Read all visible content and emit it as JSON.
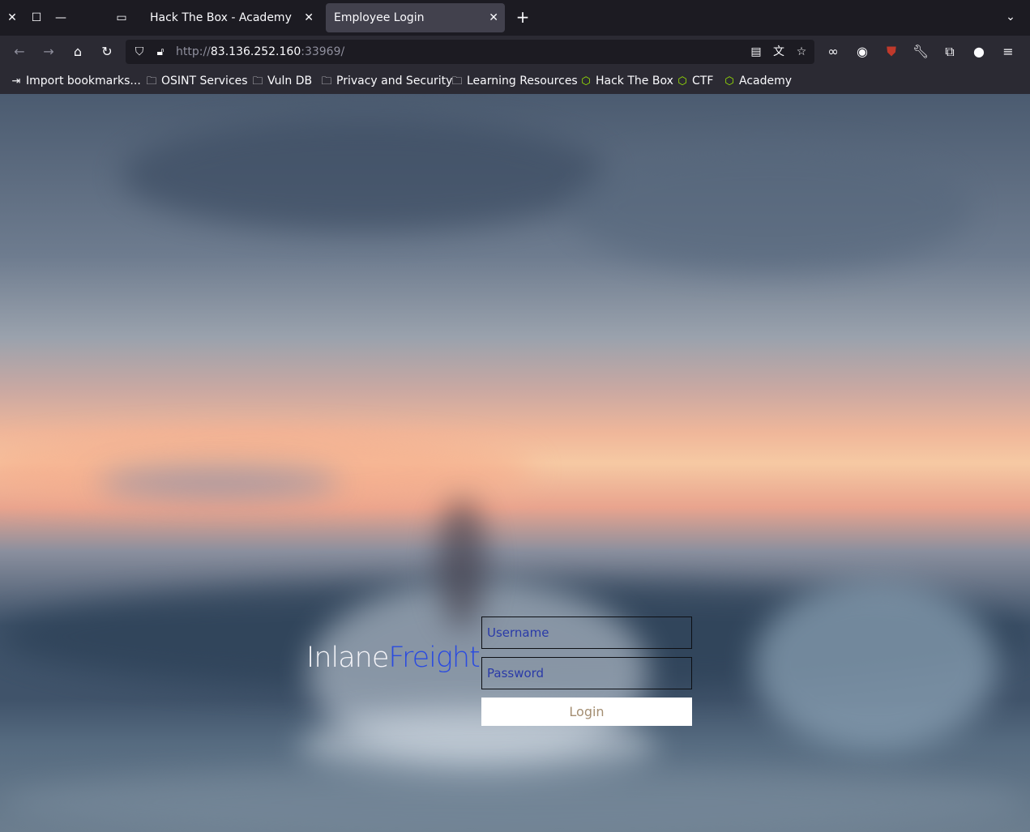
{
  "browser": {
    "tabs": [
      {
        "label": "Hack The Box - Academy",
        "active": false
      },
      {
        "label": "Employee Login",
        "active": true
      }
    ],
    "url": {
      "scheme": "http://",
      "host": "83.136.252.160",
      "rest": ":33969/"
    },
    "bookmarks": [
      {
        "label": "Import bookmarks...",
        "icon": "import-icon"
      },
      {
        "label": "OSINT Services",
        "icon": "folder-icon"
      },
      {
        "label": "Vuln DB",
        "icon": "folder-icon"
      },
      {
        "label": "Privacy and Security",
        "icon": "folder-icon"
      },
      {
        "label": "Learning Resources",
        "icon": "folder-icon"
      },
      {
        "label": "Hack The Box",
        "icon": "htb-cube-icon"
      },
      {
        "label": "CTF",
        "icon": "htb-cube-icon"
      },
      {
        "label": "Academy",
        "icon": "htb-cube-icon"
      }
    ]
  },
  "page": {
    "brand": {
      "part1": "Inlane",
      "part2": "Freight"
    },
    "username_placeholder": "Username",
    "password_placeholder": "Password",
    "login_label": "Login"
  },
  "colors": {
    "brand_white": "#f4f4f8",
    "brand_blue": "#2a4be0",
    "login_text": "#a48e72",
    "chrome_bg": "#2b2a33"
  }
}
